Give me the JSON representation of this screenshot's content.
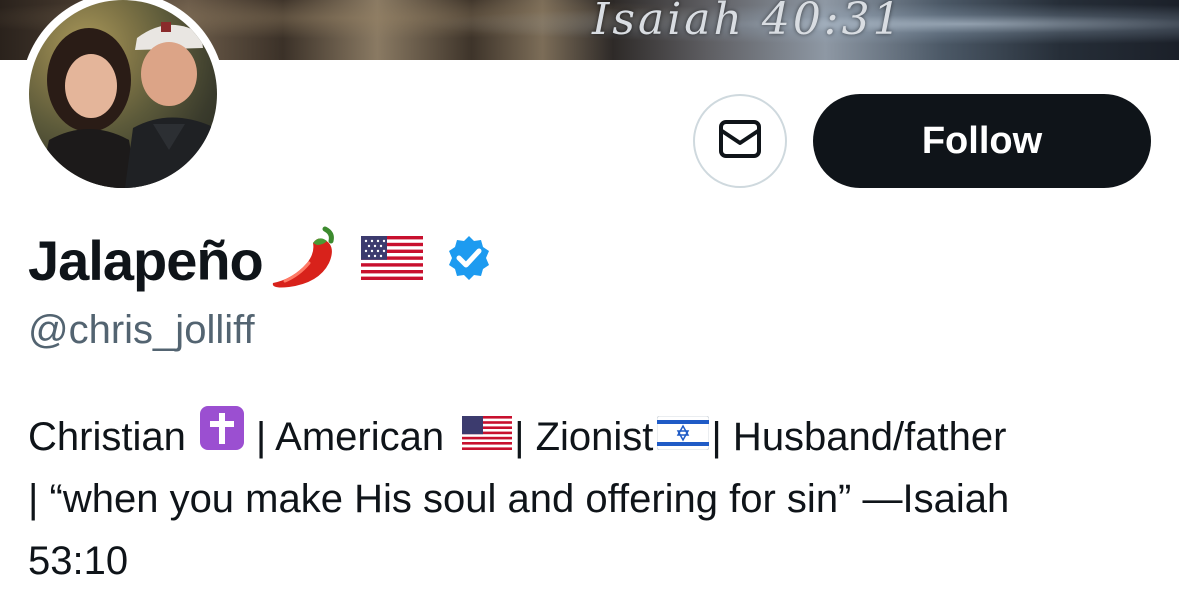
{
  "banner": {
    "verse": "Isaiah 40:31"
  },
  "profile": {
    "display_name": "Jalapeño",
    "handle": "@chris_jolliff",
    "pepper_icon": "chili-pepper-icon",
    "flag_icon": "us-flag-icon",
    "verified_icon": "verified-badge-icon",
    "verified_color": "#1d9bf0"
  },
  "actions": {
    "message_icon": "envelope-icon",
    "follow_label": "Follow"
  },
  "bio": {
    "line1": {
      "christian": "Christian",
      "sep1": "| American",
      "sep2": "| Zionist",
      "sep3": "| Husband/father"
    },
    "line2": "| “when you make His soul and offering for sin” —Isaiah",
    "line3": "53:10"
  },
  "colors": {
    "text": "#0f1419",
    "secondary": "#536471",
    "button_bg": "#0f1419",
    "border": "#cfd9de"
  }
}
